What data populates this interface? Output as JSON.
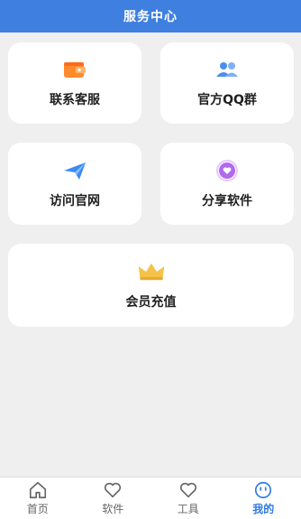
{
  "header": {
    "title": "服务中心"
  },
  "cards": {
    "service": {
      "label": "联系客服",
      "icon": "wallet-icon"
    },
    "qq": {
      "label": "官方QQ群",
      "icon": "group-icon"
    },
    "site": {
      "label": "访问官网",
      "icon": "paper-plane-icon"
    },
    "share": {
      "label": "分享软件",
      "icon": "heart-circle-icon"
    },
    "vip": {
      "label": "会员充值",
      "icon": "crown-icon"
    }
  },
  "tabs": [
    {
      "label": "首页",
      "icon": "home-icon"
    },
    {
      "label": "软件",
      "icon": "heart-icon"
    },
    {
      "label": "工具",
      "icon": "heart-outline-icon"
    },
    {
      "label": "我的",
      "icon": "smiley-icon",
      "active": true
    }
  ],
  "colors": {
    "header": "#3f7fe0",
    "active_tab": "#2f79e6",
    "background": "#efefef"
  }
}
